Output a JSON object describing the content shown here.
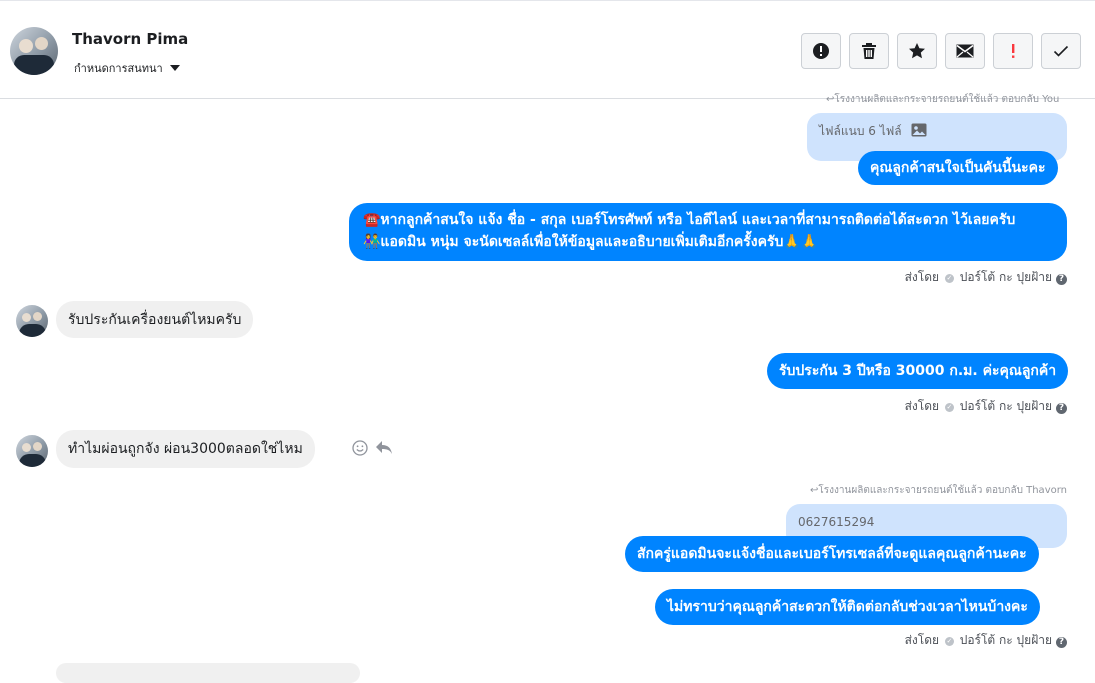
{
  "header": {
    "name": "Thavorn Pima",
    "subtitle": "กำหนดการสนทนา",
    "toolbar": [
      "info-icon",
      "trash-icon",
      "star-icon",
      "envelope-icon",
      "exclaim-icon",
      "check-icon"
    ]
  },
  "colors": {
    "outgoing": "#0084ff",
    "incoming": "#f0f0f0",
    "quoted": "#cfe3fd",
    "danger": "#fa383e"
  },
  "messages": {
    "top_reply_note": "โรงงานผลิตและกระจายรถยนต์ใช้แล้ว ตอบกลับ You",
    "quote_attachment": "ไฟล์แนบ 6 ไฟล์",
    "out1": "คุณลูกค้าสนใจเป็นคันนี้นะคะ",
    "out2_line1": "☎️หากลูกค้าสนใจ แจ้ง ชื่อ - สกุล เบอร์โทรศัพท์ หรือ ไอดีไลน์ และเวลาที่สามารถติดต่อได้สะดวก ไว้เลยครับ",
    "out2_line2": "👫แอดมิน หนุ่ม จะนัดเซลล์เพื่อให้ข้อมูลและอธิบายเพิ่มเติมอีกครั้งครับ🙏🙏",
    "sent_by_label": "ส่งโดย",
    "sent_by_name": "ปอร์โต้ กะ ปุยฝ้าย",
    "in1": "รับประกันเครื่องยนต์ไหมครับ",
    "out3": "รับประกัน 3 ปีหรือ 30000 ก.ม. ค่ะคุณลูกค้า",
    "in2": "ทำไมผ่อนถูกจัง  ผ่อน3000ตลอดใช่ไหม",
    "reply_note2": "โรงงานผลิตและกระจายรถยนต์ใช้แล้ว ตอบกลับ Thavorn",
    "quote2": "0627615294",
    "out4": "สักครู่แอดมินจะแจ้งชื่อและเบอร์โทรเซลล์ที่จะดูแลคุณลูกค้านะคะ",
    "out5": "ไม่ทราบว่าคุณลูกค้าสะดวกให้ติดต่อกลับช่วงเวลาไหนบ้างคะ"
  }
}
